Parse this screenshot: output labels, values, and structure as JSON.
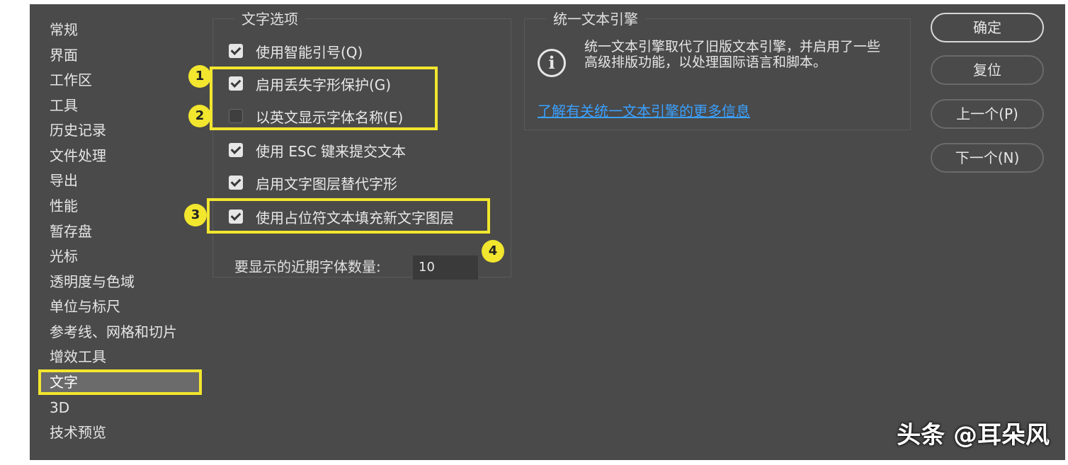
{
  "sidebar": {
    "items": [
      {
        "label": "常规"
      },
      {
        "label": "界面"
      },
      {
        "label": "工作区"
      },
      {
        "label": "工具"
      },
      {
        "label": "历史记录"
      },
      {
        "label": "文件处理"
      },
      {
        "label": "导出"
      },
      {
        "label": "性能"
      },
      {
        "label": "暂存盘"
      },
      {
        "label": "光标"
      },
      {
        "label": "透明度与色域"
      },
      {
        "label": "单位与标尺"
      },
      {
        "label": "参考线、网格和切片"
      },
      {
        "label": "增效工具"
      },
      {
        "label": "文字"
      },
      {
        "label": "3D"
      },
      {
        "label": "技术预览"
      }
    ],
    "active": "文字"
  },
  "text_options": {
    "title": "文字选项",
    "options": [
      {
        "label": "使用智能引号(Q)",
        "checked": true
      },
      {
        "label": "启用丢失字形保护(G)",
        "checked": true
      },
      {
        "label": "以英文显示字体名称(E)",
        "checked": false
      },
      {
        "label": "使用 ESC 键来提交文本",
        "checked": true
      },
      {
        "label": "启用文字图层替代字形",
        "checked": true
      },
      {
        "label": "使用占位符文本填充新文字图层",
        "checked": true
      }
    ],
    "recent_fonts_label": "要显示的近期字体数量:",
    "recent_fonts_value": "10"
  },
  "badges": [
    "1",
    "2",
    "3",
    "4"
  ],
  "engine": {
    "title": "统一文本引擎",
    "icon": "info-icon",
    "description": "统一文本引擎取代了旧版文本引擎，并启用了一些高级排版功能，以处理国际语言和脚本。",
    "link": "了解有关统一文本引擎的更多信息"
  },
  "buttons": {
    "ok": "确定",
    "reset": "复位",
    "prev": "上一个(P)",
    "next": "下一个(N)"
  },
  "watermark": "头条 @耳朵风",
  "colors": {
    "dialog_bg": "#4a4a4a",
    "highlight": "#f2e62e",
    "link": "#3aa0ff"
  }
}
